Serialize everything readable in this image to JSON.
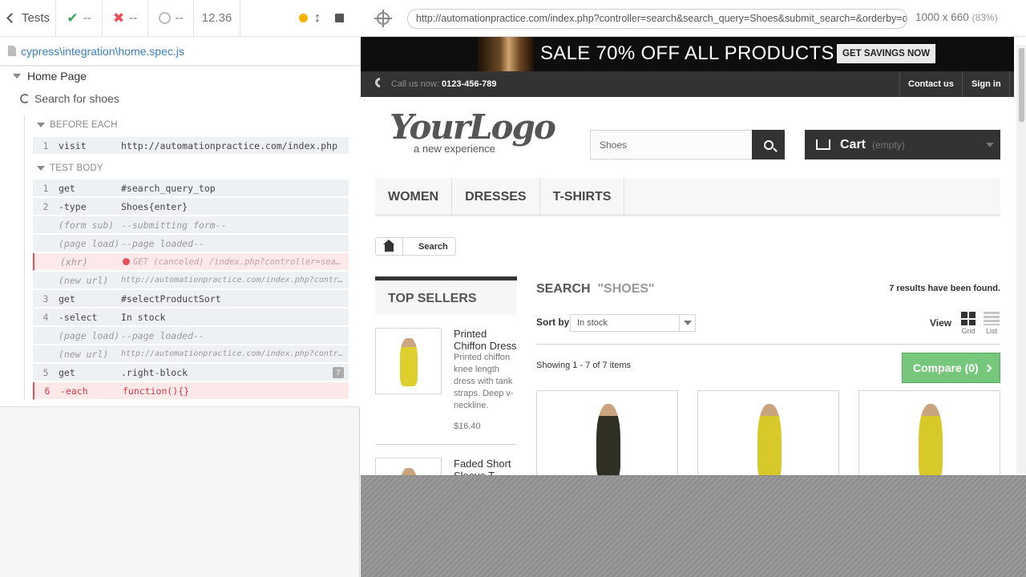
{
  "reporter": {
    "tests_label": "Tests",
    "passed": "--",
    "failed": "--",
    "pending": "--",
    "duration": "12.36",
    "spec_path": "cypress\\integration\\home.spec.js",
    "suite": "Home Page",
    "test": "Search for shoes",
    "before_each_label": "BEFORE EACH",
    "test_body_label": "TEST BODY",
    "before_each": [
      {
        "num": "1",
        "name": "visit",
        "message": "http://automationpractice.com/index.php"
      }
    ],
    "commands": [
      {
        "num": "1",
        "name": "get",
        "message": "#search_query_top"
      },
      {
        "num": "2",
        "name": "-type",
        "message": "Shoes{enter}"
      },
      {
        "num": "",
        "name": "(form sub)",
        "message": "--submitting form--"
      },
      {
        "num": "",
        "name": "(page load)",
        "message": "--page loaded--"
      },
      {
        "num": "",
        "name": "(xhr)",
        "message": "GET (canceled) /index.php?controller=search&q=..."
      },
      {
        "num": "",
        "name": "(new url)",
        "message": "http://automationpractice.com/index.php?controll..."
      },
      {
        "num": "3",
        "name": "get",
        "message": "#selectProductSort"
      },
      {
        "num": "4",
        "name": "-select",
        "message": "In stock"
      },
      {
        "num": "",
        "name": "(page load)",
        "message": "--page loaded--"
      },
      {
        "num": "",
        "name": "(new url)",
        "message": "http://automationpractice.com/index.php?controll..."
      },
      {
        "num": "5",
        "name": "get",
        "message": ".right-block",
        "count": "7"
      },
      {
        "num": "6",
        "name": "-each",
        "message": "function(){}"
      }
    ]
  },
  "aut": {
    "url": "http://automationpractice.com/index.php?controller=search&search_query=Shoes&submit_search=&orderby=quantity&orderway=desc",
    "viewport": "1000 x 660",
    "scale": "(83%)"
  },
  "site": {
    "banner_text": "SALE 70% OFF ALL PRODUCTS",
    "banner_button": "GET SAVINGS NOW",
    "call_label": "Call us now:",
    "phone": "0123-456-789",
    "contact": "Contact us",
    "signin": "Sign in",
    "logo_main": "YourLogo",
    "logo_sub": "a new experience",
    "search_value": "Shoes",
    "cart_label": "Cart",
    "cart_state": "(empty)",
    "menu": [
      "WOMEN",
      "DRESSES",
      "T-SHIRTS"
    ],
    "breadcrumb": "Search",
    "top_sellers_title": "TOP SELLERS",
    "top_sellers": [
      {
        "name": "Printed Chiffon Dress",
        "desc": "Printed chiffon knee length dress with tank straps. Deep v-neckline.",
        "price": "$16.40"
      },
      {
        "name": "Faded Short Sleeve T-shirts",
        "desc": "",
        "price": ""
      }
    ],
    "search_heading": "SEARCH",
    "search_term": "\"SHOES\"",
    "results": "7 results have been found.",
    "sort_label": "Sort by",
    "sort_value": "In stock",
    "view_label": "View",
    "grid_label": "Grid",
    "list_label": "List",
    "showing": "Showing 1 - 7 of 7 items",
    "compare": "Compare (0)"
  }
}
